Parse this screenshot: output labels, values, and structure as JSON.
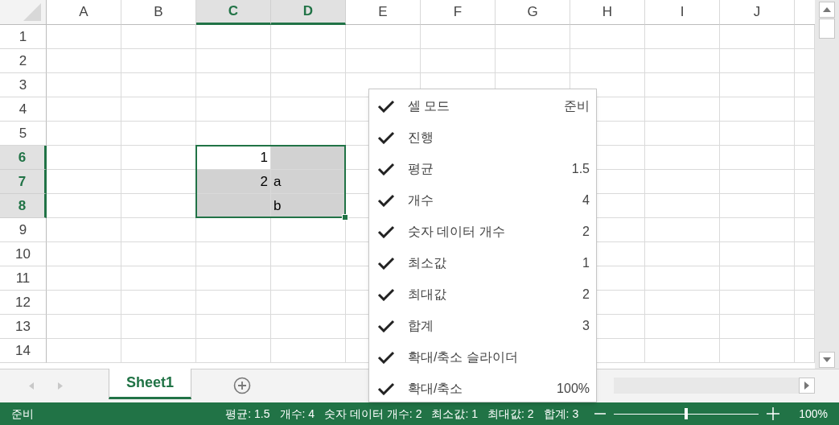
{
  "columns": [
    {
      "label": "A",
      "selected": false
    },
    {
      "label": "B",
      "selected": false
    },
    {
      "label": "C",
      "selected": true
    },
    {
      "label": "D",
      "selected": true
    },
    {
      "label": "E",
      "selected": false
    },
    {
      "label": "F",
      "selected": false
    },
    {
      "label": "G",
      "selected": false
    },
    {
      "label": "H",
      "selected": false
    },
    {
      "label": "I",
      "selected": false
    },
    {
      "label": "J",
      "selected": false
    }
  ],
  "rows": [
    {
      "label": "1",
      "selected": false
    },
    {
      "label": "2",
      "selected": false
    },
    {
      "label": "3",
      "selected": false
    },
    {
      "label": "4",
      "selected": false
    },
    {
      "label": "5",
      "selected": false
    },
    {
      "label": "6",
      "selected": true,
      "cells": [
        {
          "text": "1",
          "kind": "number",
          "active": true
        },
        {
          "active": false
        }
      ]
    },
    {
      "label": "7",
      "selected": true,
      "cells": [
        {
          "text": "2",
          "kind": "number",
          "active": false
        },
        {
          "text": "a",
          "kind": "text",
          "active": false
        }
      ]
    },
    {
      "label": "8",
      "selected": true,
      "cells": [
        {
          "active": false
        },
        {
          "text": "b",
          "kind": "text",
          "active": false
        }
      ]
    },
    {
      "label": "9",
      "selected": false
    },
    {
      "label": "10",
      "selected": false
    },
    {
      "label": "11",
      "selected": false
    },
    {
      "label": "12",
      "selected": false
    },
    {
      "label": "13",
      "selected": false
    },
    {
      "label": "14",
      "selected": false
    }
  ],
  "sheet_tabs": [
    {
      "label": "Sheet1",
      "selected": true
    }
  ],
  "context_menu": [
    {
      "label": "셀 모드",
      "value": "준비",
      "checked": true
    },
    {
      "label": "진행",
      "checked": true
    },
    {
      "label": "평균",
      "value": "1.5",
      "checked": true
    },
    {
      "label": "개수",
      "value": "4",
      "checked": true
    },
    {
      "label": "숫자 데이터 개수",
      "value": "2",
      "checked": true
    },
    {
      "label": "최소값",
      "value": "1",
      "checked": true
    },
    {
      "label": "최대값",
      "value": "2",
      "checked": true
    },
    {
      "label": "합계",
      "value": "3",
      "checked": true
    },
    {
      "label": "확대/축소 슬라이더",
      "checked": true
    },
    {
      "label": "확대/축소",
      "value": "100%",
      "checked": true
    }
  ],
  "status_bar": {
    "mode": "준비",
    "stats": [
      "평균: 1.5",
      "개수: 4",
      "숫자 데이터 개수: 2",
      "최소값: 1",
      "최대값: 2",
      "합계: 3"
    ],
    "zoom_slider": {
      "level": 0.5
    },
    "zoom": "100%"
  }
}
